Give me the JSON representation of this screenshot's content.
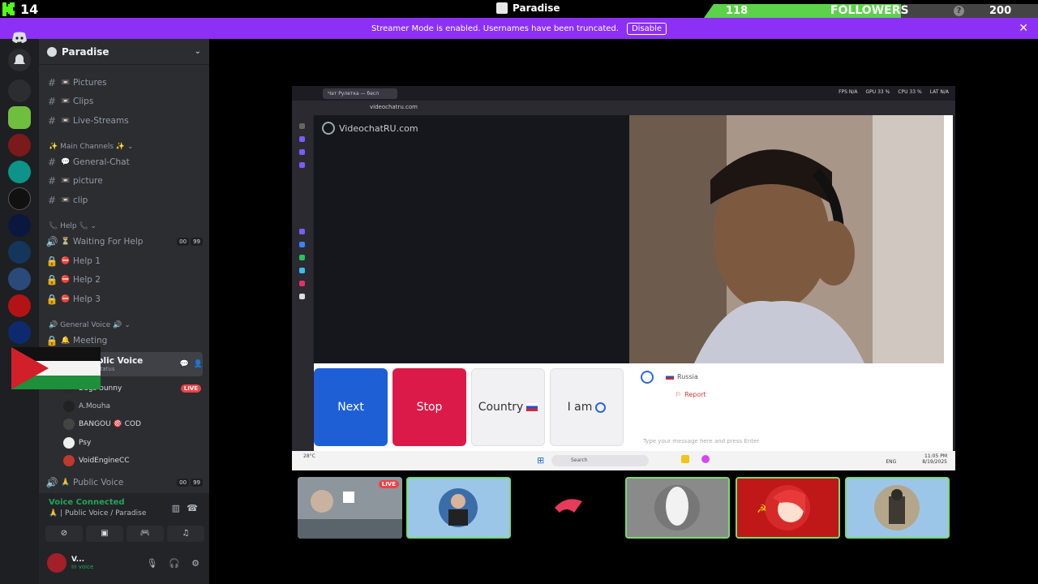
{
  "overlay": {
    "viewer_count": "14",
    "server_name": "Paradise",
    "followers_current": "118",
    "followers_label": "FOLLOWERS",
    "followers_goal": "200",
    "followers_progress": 0.59,
    "help_glyph": "?"
  },
  "streamer_mode": {
    "message": "Streamer Mode is enabled. Usernames have been truncated.",
    "disable_label": "Disable",
    "close_glyph": "✕"
  },
  "sidebar": {
    "server_title": "Paradise",
    "chevron": "⌄",
    "channels": [
      {
        "label": "Pictures",
        "emoji": "📼"
      },
      {
        "label": "Clips",
        "emoji": "📼"
      },
      {
        "label": "Live-Streams",
        "emoji": "📼"
      }
    ],
    "category_main": "✨ Main Channels ✨ ⌄",
    "main_channels": [
      {
        "label": "General-Chat",
        "emoji": "💬"
      },
      {
        "label": "picture",
        "emoji": "📼"
      },
      {
        "label": "clip",
        "emoji": "📼"
      }
    ],
    "category_help": "📞 Help 📞 ⌄",
    "help_channels": [
      {
        "label": "Waiting For Help",
        "emoji": "⏳",
        "counts": [
          "00",
          "99"
        ]
      },
      {
        "label": "Help 1",
        "emoji": "⛔"
      },
      {
        "label": "Help 2",
        "emoji": "⛔"
      },
      {
        "label": "Help 3",
        "emoji": "⛔"
      }
    ],
    "category_voice": "🔊 General Voice 🔊 ⌄",
    "meeting": {
      "label": "Meeting",
      "emoji": "🔔"
    },
    "public_voice_active": "blic Voice",
    "status_hint": "status",
    "members": [
      {
        "name": "Bugs bunny",
        "live": "LIVE"
      },
      {
        "name": "A.Mouha"
      },
      {
        "name": "BANGOU 🎯 COD"
      },
      {
        "name": "Psy"
      },
      {
        "name": "VoidEngineCC"
      }
    ],
    "public_voice_2": {
      "label": "Public Voice",
      "emoji": "🙏",
      "counts": [
        "00",
        "99"
      ]
    }
  },
  "voice_panel": {
    "status": "Voice Connected",
    "location": "🙏 | Public Voice / Paradise",
    "user_name": "V...",
    "user_status": "In voice"
  },
  "shared_screen": {
    "tab_title": "Чат Рулетка — бесп",
    "url": "videochatru.com",
    "stats": [
      "FPS N/A",
      "GPU 33 %",
      "CPU 33 %",
      "LAT N/A"
    ],
    "brand": "VideochatRU.com",
    "buttons": {
      "next": "Next",
      "stop": "Stop",
      "country": "Country",
      "iam": "I am"
    },
    "peer_country": "Russia",
    "report_label": "Report",
    "message_placeholder": "Type your message here and press Enter",
    "taskbar": {
      "weather": "28°C",
      "search": "Search",
      "lang": "ENG",
      "time": "11:05 PM",
      "date": "8/19/2025"
    }
  },
  "tiles": [
    {
      "live": "LIVE"
    },
    {},
    {},
    {},
    {},
    {}
  ],
  "colors": {
    "discord_bg": "#2b2d31",
    "rail_bg": "#1e1f22",
    "streamer_purple": "#8c30f5",
    "follow_green": "#5bd24a",
    "next_blue": "#1f5fd6",
    "stop_red": "#dc1a49",
    "live_red": "#ed4245"
  }
}
